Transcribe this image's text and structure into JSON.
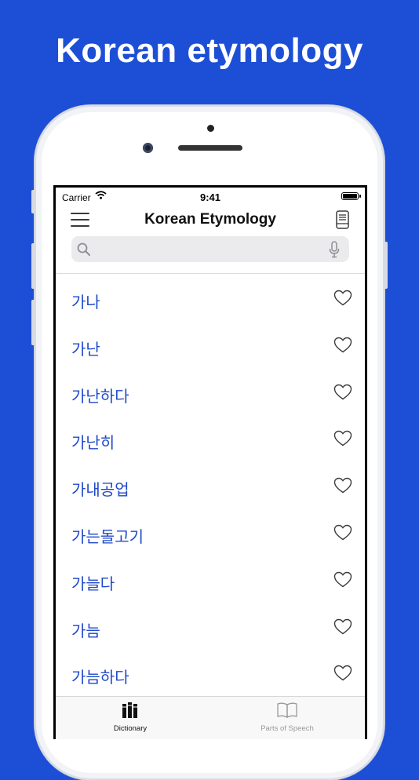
{
  "headline": "Korean etymology",
  "status": {
    "carrier": "Carrier",
    "time": "9:41",
    "battery": 1.0
  },
  "navbar": {
    "title": "Korean Etymology"
  },
  "search": {
    "value": "",
    "placeholder": ""
  },
  "entries": [
    {
      "word": "가나"
    },
    {
      "word": "가난"
    },
    {
      "word": "가난하다"
    },
    {
      "word": "가난히"
    },
    {
      "word": "가내공업"
    },
    {
      "word": "가는돌고기"
    },
    {
      "word": "가늘다"
    },
    {
      "word": "가늠"
    },
    {
      "word": "가늠하다"
    }
  ],
  "tabs": [
    {
      "label": "Dictionary",
      "icon": "books-icon",
      "active": true
    },
    {
      "label": "Parts of Speech",
      "icon": "open-book-icon",
      "active": false
    }
  ],
  "colors": {
    "background": "#1d4fd6",
    "accent": "#1f49c9"
  }
}
